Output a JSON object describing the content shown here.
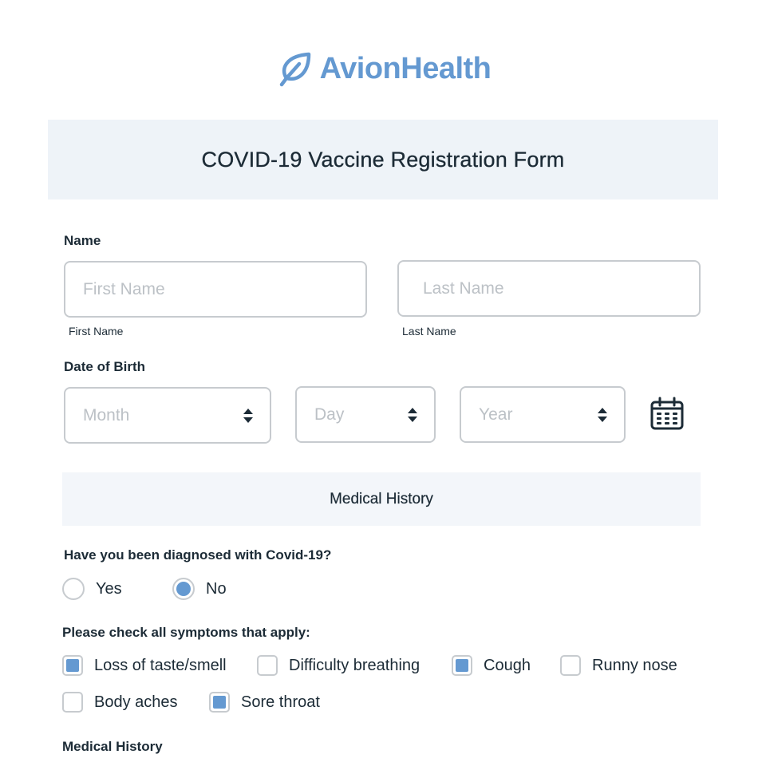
{
  "brand": {
    "name": "AvionHealth",
    "logo_icon": "leaf-icon",
    "color": "#6499d1"
  },
  "form": {
    "title": "COVID-19 Vaccine Registration Form",
    "name_section": {
      "label": "Name",
      "first_name": {
        "placeholder": "First Name",
        "value": "",
        "sublabel": "First Name"
      },
      "last_name": {
        "placeholder": "Last Name",
        "value": "",
        "sublabel": "Last Name"
      }
    },
    "dob_section": {
      "label": "Date of Birth",
      "month": {
        "placeholder": "Month"
      },
      "day": {
        "placeholder": "Day"
      },
      "year": {
        "placeholder": "Year"
      },
      "calendar_icon": "calendar-icon"
    },
    "medical_history_banner": "Medical History",
    "covid_question": {
      "label": "Have you been diagnosed with Covid-19?",
      "options": [
        {
          "label": "Yes",
          "checked": false
        },
        {
          "label": "No",
          "checked": true
        }
      ]
    },
    "symptoms": {
      "label": "Please check all symptoms that apply:",
      "options": [
        {
          "label": "Loss of taste/smell",
          "checked": true
        },
        {
          "label": "Difficulty breathing",
          "checked": false
        },
        {
          "label": "Cough",
          "checked": true
        },
        {
          "label": "Runny nose",
          "checked": false
        },
        {
          "label": "Body aches",
          "checked": false
        },
        {
          "label": "Sore throat",
          "checked": true
        }
      ]
    },
    "medical_history_label": "Medical History"
  },
  "colors": {
    "accent": "#6499d1",
    "text": "#1c2b36",
    "border": "#c7cbcf",
    "placeholder": "#bcc1c6",
    "banner_bg": "#eef3f8"
  }
}
